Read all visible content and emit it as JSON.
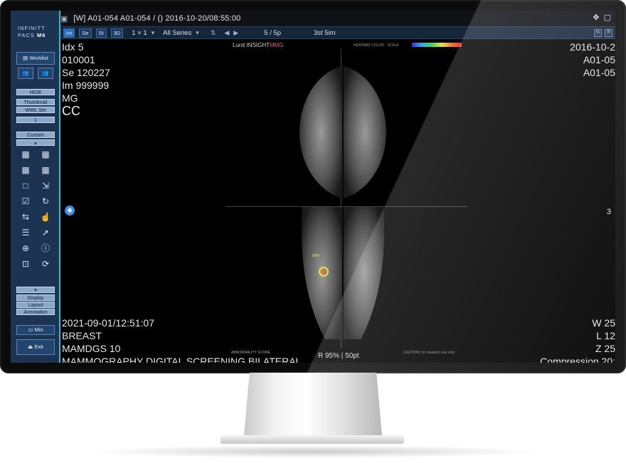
{
  "topbar": {
    "title": "[W] A01-054  A01-054  / ()  2016-10-20/08:55:00"
  },
  "toolbar": {
    "btn_im": "Im",
    "btn_se": "Se",
    "btn_st": "St",
    "btn_3d": "3D",
    "layout": "1 × 1",
    "series": "All Series",
    "page": "5 / 5p",
    "time": "3st  5im"
  },
  "sidebar": {
    "logo_line1": "INFINITT",
    "logo_pacs": "PACS",
    "logo_m6": "M6",
    "worklist": "Worklist",
    "hide": "HIDE",
    "thumbnail": "Thumbnail",
    "wwl_set": "WWL Set",
    "one": "1",
    "custom": "Custom",
    "display": "Display",
    "layout": "Layout",
    "annotation": "Annotation",
    "min": "Min",
    "exit": "Exit"
  },
  "overlay": {
    "top_left": [
      "Idx 5",
      "010001",
      "Se 120227",
      "Im 999999",
      "MG"
    ],
    "view": "CC",
    "top_right": [
      "2016-10-2",
      "A01-05",
      "A01-05"
    ],
    "bottom_left": [
      "2021-09-01/12:51:07",
      "BREAST",
      "MAMDGS 10",
      "MAMMOGRAPHY DIGITAL SCREENING BILATERAL"
    ],
    "bottom_right": [
      "W 25",
      "L 12",
      "Z 25",
      "Compression 20:"
    ],
    "side_marker": "3",
    "lunit_brand": "Lunit INSIGHT",
    "lunit_mmg": "MMG",
    "heatmap_label": "HEATMAP COLOR · SCALE",
    "bottom_center": "R 95%  |  50pt",
    "abnormality": "ABNORMALITY SCORE",
    "caution": "CAUTION: for research use only",
    "lesion_score": "95%"
  },
  "colors": {
    "sidebar_bg": "#1c3352",
    "accent": "#35b7d6",
    "toolbar_bg": "#16263a"
  }
}
